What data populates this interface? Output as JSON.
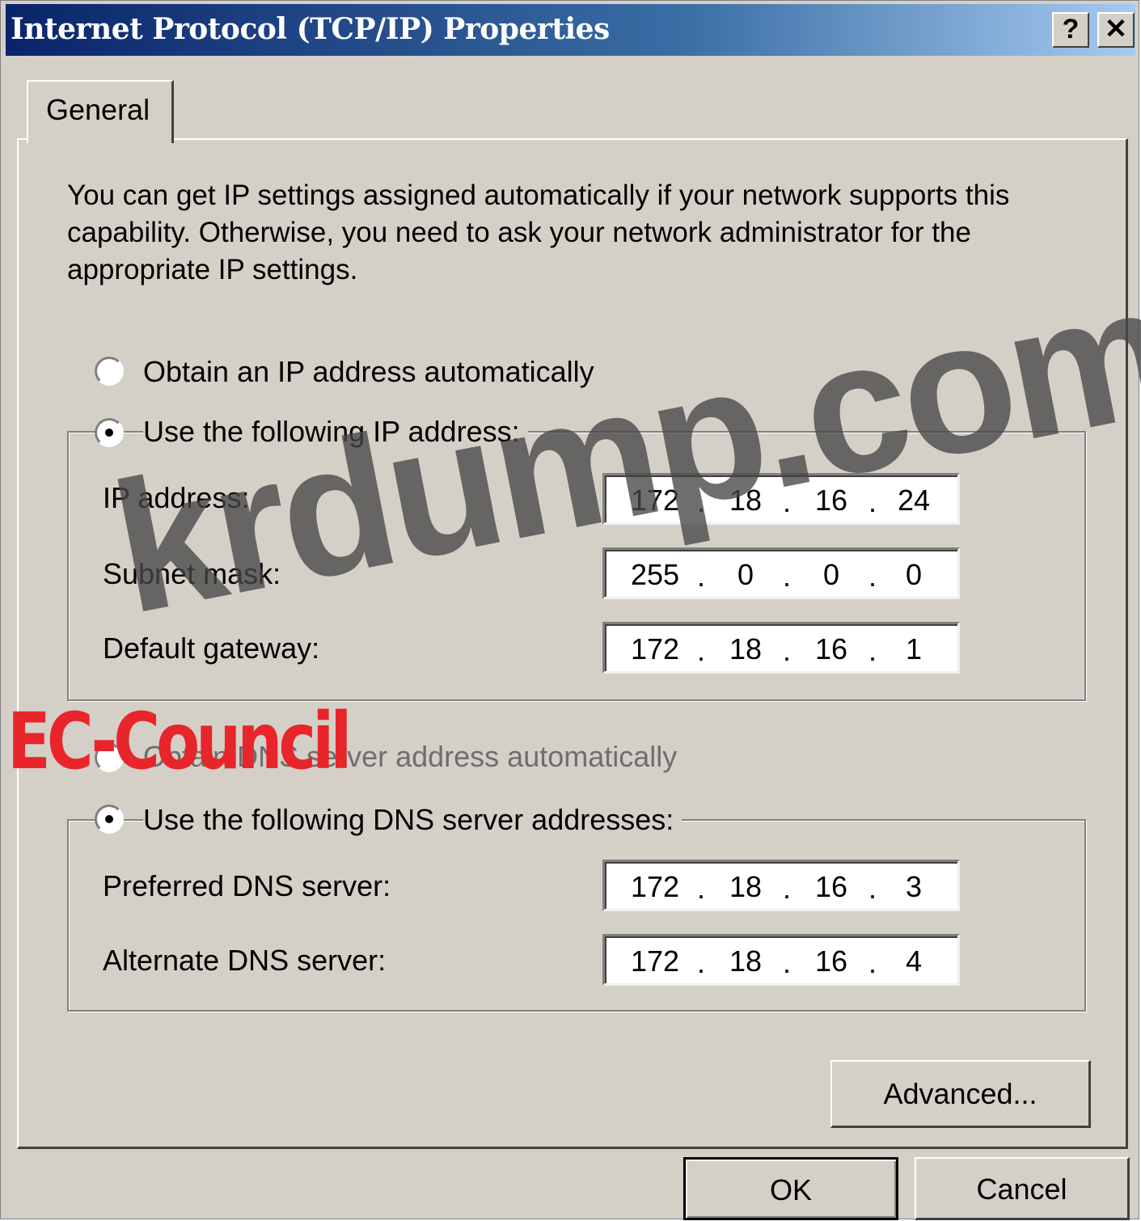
{
  "window": {
    "title": "Internet Protocol (TCP/IP) Properties",
    "help_button": "?",
    "close_button": "✕"
  },
  "tabs": [
    {
      "label": "General",
      "selected": true
    }
  ],
  "description": "You can get IP settings assigned automatically if your network supports this capability. Otherwise, you need to ask your network administrator for the appropriate IP settings.",
  "ip_section": {
    "auto_option": {
      "label": "Obtain an IP address automatically",
      "selected": false
    },
    "manual_option": {
      "label": "Use the following IP address:",
      "selected": true
    },
    "fields": [
      {
        "label": "IP address:",
        "octets": [
          "172",
          "18",
          "16",
          "24"
        ]
      },
      {
        "label": "Subnet mask:",
        "octets": [
          "255",
          "0",
          "0",
          "0"
        ]
      },
      {
        "label": "Default gateway:",
        "octets": [
          "172",
          "18",
          "16",
          "1"
        ]
      }
    ]
  },
  "dns_section": {
    "auto_option": {
      "label": "Obtain DNS server address automatically",
      "selected": false,
      "disabled": true
    },
    "manual_option": {
      "label": "Use the following DNS server addresses:",
      "selected": true
    },
    "fields": [
      {
        "label": "Preferred DNS server:",
        "octets": [
          "172",
          "18",
          "16",
          "3"
        ]
      },
      {
        "label": "Alternate DNS server:",
        "octets": [
          "172",
          "18",
          "16",
          "4"
        ]
      }
    ]
  },
  "buttons": {
    "advanced": "Advanced...",
    "ok": "OK",
    "cancel": "Cancel"
  },
  "watermarks": {
    "krdump": "krdump.com",
    "ec_council": "EC-Council"
  },
  "colors": {
    "dialog_bg": "#d4d0c8",
    "titlebar_start": "#0a246a",
    "titlebar_end": "#a6caf0",
    "watermark_red": "#e8252a"
  }
}
